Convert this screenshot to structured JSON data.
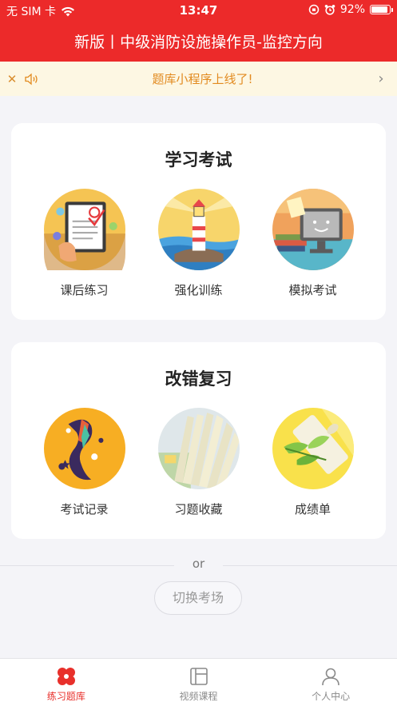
{
  "status_bar": {
    "carrier": "无 SIM 卡",
    "time": "13:47",
    "battery": "92%",
    "battery_level": 0.92
  },
  "header": {
    "title": "新版丨中级消防设施操作员-监控方向"
  },
  "notice": {
    "text": "题库小程序上线了!",
    "close_icon": "close-icon",
    "speaker_icon": "speaker-icon",
    "chevron_icon": "chevron-right-icon"
  },
  "study": {
    "title": "学习考试",
    "items": [
      {
        "label": "课后练习",
        "icon": "exercise-icon"
      },
      {
        "label": "强化训练",
        "icon": "lighthouse-icon"
      },
      {
        "label": "模拟考试",
        "icon": "monitor-icon"
      }
    ]
  },
  "review": {
    "title": "改错复习",
    "items": [
      {
        "label": "考试记录",
        "icon": "record-icon"
      },
      {
        "label": "习题收藏",
        "icon": "book-icon"
      },
      {
        "label": "成绩单",
        "icon": "scroll-icon"
      }
    ]
  },
  "divider": {
    "text": "or"
  },
  "switch_button": {
    "label": "切换考场"
  },
  "tabs": [
    {
      "label": "练习题库",
      "active": true,
      "icon": "practice-icon"
    },
    {
      "label": "视频课程",
      "active": false,
      "icon": "video-icon"
    },
    {
      "label": "个人中心",
      "active": false,
      "icon": "user-icon"
    }
  ],
  "colors": {
    "brand": "#ec2a2a",
    "notice_bg": "#fdf7e3",
    "notice_text": "#e28a1f",
    "tab_active": "#e8302b"
  }
}
